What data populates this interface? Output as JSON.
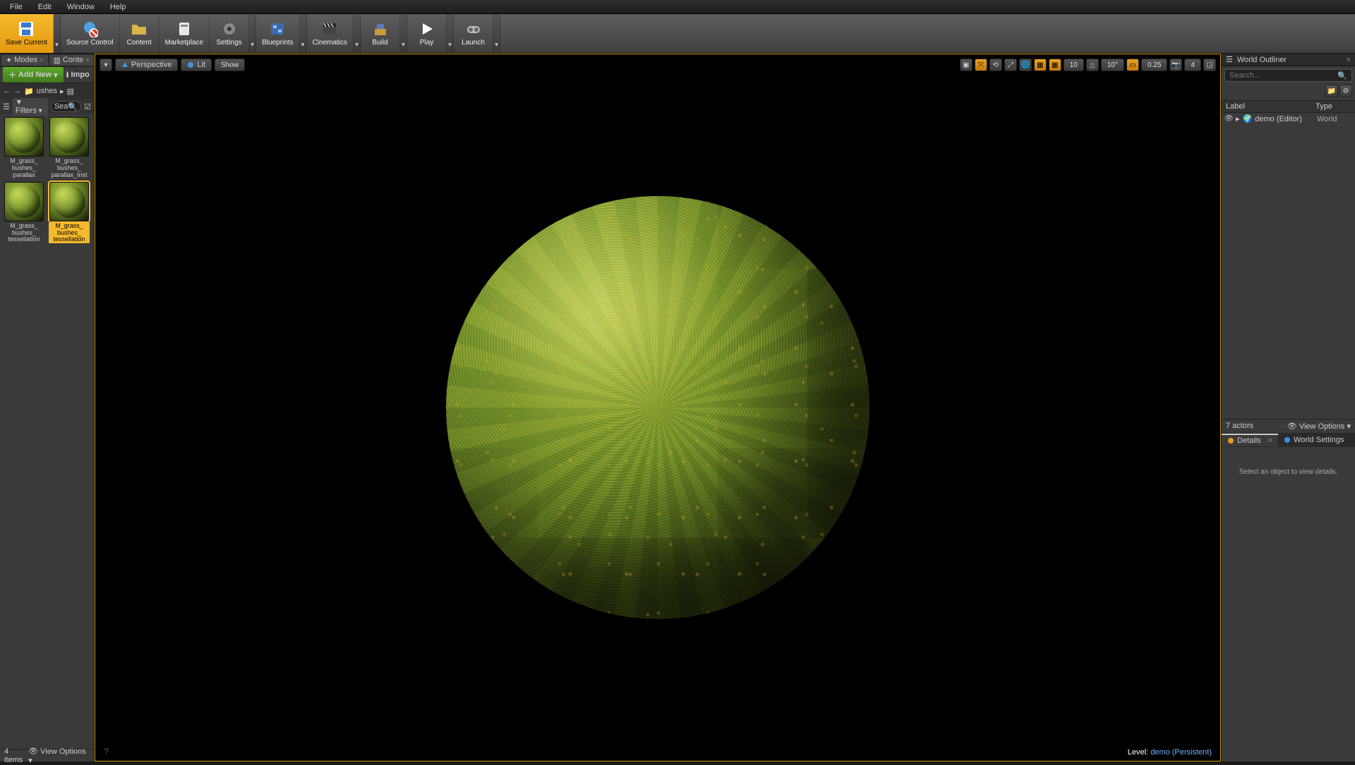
{
  "menu": {
    "file": "File",
    "edit": "Edit",
    "window": "Window",
    "help": "Help"
  },
  "toolbar": {
    "save": "Save Current",
    "source_control": "Source Control",
    "content": "Content",
    "marketplace": "Marketplace",
    "settings": "Settings",
    "blueprints": "Blueprints",
    "cinematics": "Cinematics",
    "build": "Build",
    "play": "Play",
    "launch": "Launch"
  },
  "content_browser": {
    "tab_modes": "Modes",
    "tab_content": "Conte",
    "add_new": "Add New",
    "import": "Impo",
    "path": "ushes",
    "filters": "Filters",
    "search_placeholder": "Sea",
    "items": [
      {
        "name": "M_grass_ bushes_ parallax"
      },
      {
        "name": "M_grass_ bushes_ parallax_Inst"
      },
      {
        "name": "M_grass_ bushes_ tessellation"
      },
      {
        "name": "M_grass_ bushes_ tessellation"
      }
    ],
    "count": "4 items",
    "view_options": "View Options"
  },
  "viewport": {
    "menu_drop": "▾",
    "perspective": "Perspective",
    "lit": "Lit",
    "show": "Show",
    "snap_translate": "10",
    "snap_rotate": "10°",
    "snap_scale": "0.25",
    "cam_speed": "4",
    "level_label": "Level:",
    "level_value": "demo (Persistent)"
  },
  "outliner": {
    "title": "World Outliner",
    "search_placeholder": "Search...",
    "col_label": "Label",
    "col_type": "Type",
    "rows": [
      {
        "name": "demo (Editor)",
        "type": "World"
      }
    ],
    "actors": "7 actors",
    "view_options": "View Options"
  },
  "details": {
    "tab_details": "Details",
    "tab_world": "World Settings",
    "empty": "Select an object to view details."
  }
}
